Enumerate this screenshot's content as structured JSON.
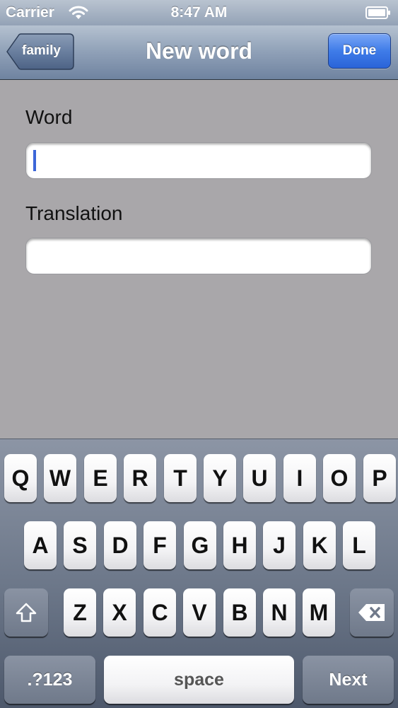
{
  "status_bar": {
    "carrier": "Carrier",
    "time": "8:47 AM"
  },
  "nav": {
    "back_label": "family",
    "title": "New word",
    "done_label": "Done"
  },
  "form": {
    "word_label": "Word",
    "word_value": "",
    "translation_label": "Translation",
    "translation_value": ""
  },
  "keyboard": {
    "row1": [
      "Q",
      "W",
      "E",
      "R",
      "T",
      "Y",
      "U",
      "I",
      "O",
      "P"
    ],
    "row2": [
      "A",
      "S",
      "D",
      "F",
      "G",
      "H",
      "J",
      "K",
      "L"
    ],
    "row3": [
      "Z",
      "X",
      "C",
      "V",
      "B",
      "N",
      "M"
    ],
    "numbers_label": ".?123",
    "space_label": "space",
    "next_label": "Next"
  },
  "colors": {
    "nav_bar": "#8fa0b7",
    "done_button": "#3f7ce8",
    "background": "#a9a7aa",
    "cursor": "#3d66d8"
  }
}
